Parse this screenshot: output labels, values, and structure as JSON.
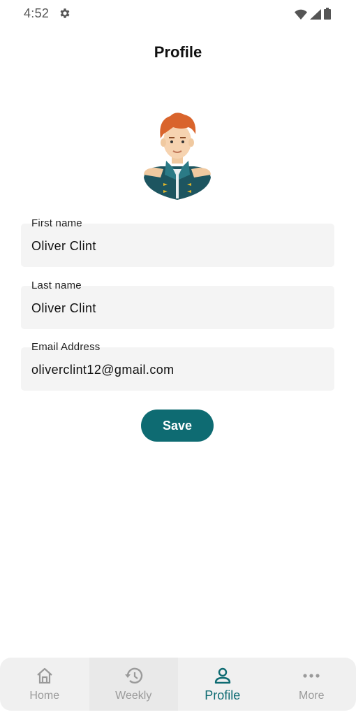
{
  "status_bar": {
    "time": "4:52",
    "icons": [
      "gear-icon",
      "wifi-icon",
      "signal-icon",
      "battery-icon"
    ]
  },
  "header": {
    "title": "Profile"
  },
  "profile": {
    "avatar": "avatar-illustration",
    "fields": [
      {
        "label": "First name",
        "value": "Oliver Clint"
      },
      {
        "label": "Last name",
        "value": "Oliver Clint"
      },
      {
        "label": "Email Address",
        "value": "oliverclint12@gmail.com"
      }
    ],
    "save_label": "Save"
  },
  "bottom_nav": {
    "items": [
      {
        "label": "Home",
        "icon": "home-icon",
        "active": false
      },
      {
        "label": "Weekly",
        "icon": "history-icon",
        "active": false
      },
      {
        "label": "Profile",
        "icon": "person-icon",
        "active": true
      },
      {
        "label": "More",
        "icon": "more-dots-icon",
        "active": false
      }
    ]
  },
  "colors": {
    "accent": "#0e6b72",
    "field_bg": "#f4f4f4",
    "nav_bg": "#f0f0f0",
    "inactive": "#9a9a9a"
  }
}
